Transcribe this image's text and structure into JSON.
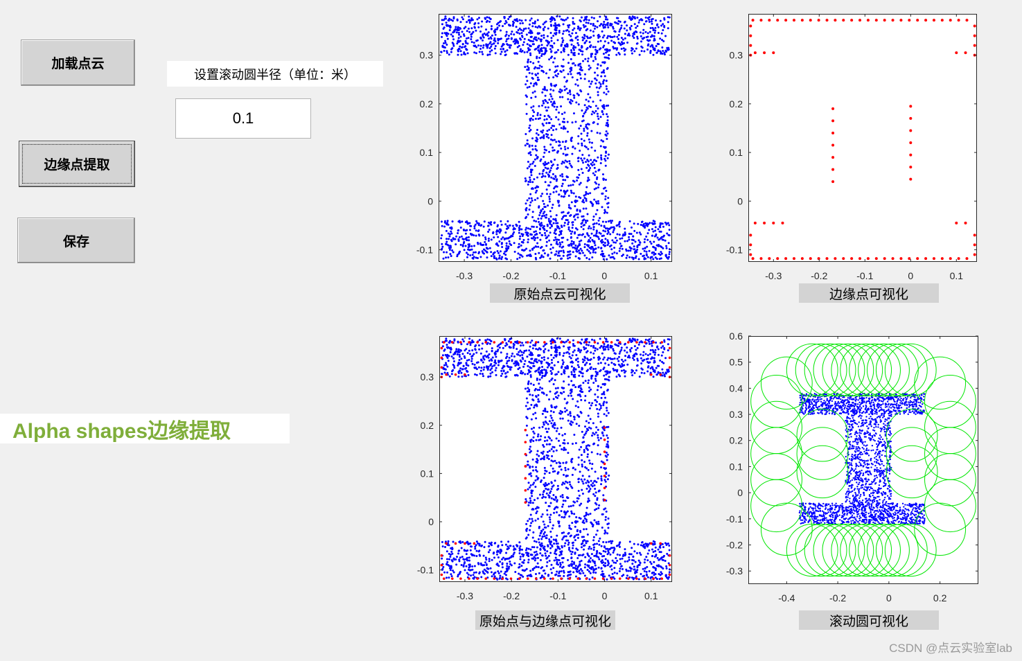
{
  "controls": {
    "load_label": "加载点云",
    "extract_label": "边缘点提取",
    "save_label": "保存",
    "radius_label": "设置滚动圆半径（单位：米）",
    "radius_value": "0.1"
  },
  "banner": {
    "title": "Alpha shapes边缘提取",
    "color": "#7fae3a"
  },
  "watermark": "CSDN @点云实验室lab",
  "colors": {
    "original": "#0000ff",
    "edge": "#ff0000",
    "circle": "#00e600"
  },
  "chart_data": [
    {
      "type": "scatter",
      "caption": "原始点云可视化",
      "xlim": [
        -0.355,
        0.145
      ],
      "ylim": [
        -0.125,
        0.385
      ],
      "xticks": [
        -0.3,
        -0.2,
        -0.1,
        0,
        0.1
      ],
      "yticks": [
        -0.1,
        0,
        0.1,
        0.2,
        0.3
      ],
      "series": [
        {
          "color": "#0000ff",
          "shape": "I-beam point cloud"
        }
      ]
    },
    {
      "type": "scatter",
      "caption": "边缘点可视化",
      "xlim": [
        -0.355,
        0.145
      ],
      "ylim": [
        -0.125,
        0.385
      ],
      "xticks": [
        -0.3,
        -0.2,
        -0.1,
        0,
        0.1
      ],
      "yticks": [
        -0.1,
        0,
        0.1,
        0.2,
        0.3
      ],
      "series": [
        {
          "color": "#ff0000",
          "shape": "boundary points"
        }
      ]
    },
    {
      "type": "scatter",
      "caption": "原始点与边缘点可视化",
      "xlim": [
        -0.355,
        0.145
      ],
      "ylim": [
        -0.125,
        0.385
      ],
      "xticks": [
        -0.3,
        -0.2,
        -0.1,
        0,
        0.1
      ],
      "yticks": [
        -0.1,
        0,
        0.1,
        0.2,
        0.3
      ],
      "series": [
        {
          "color": "#0000ff",
          "shape": "I-beam point cloud"
        },
        {
          "color": "#ff0000",
          "shape": "boundary points"
        }
      ]
    },
    {
      "type": "scatter",
      "caption": "滚动圆可视化",
      "xlim": [
        -0.55,
        0.35
      ],
      "ylim": [
        -0.35,
        0.6
      ],
      "xticks": [
        -0.4,
        -0.2,
        0,
        0.2
      ],
      "yticks": [
        -0.3,
        -0.2,
        -0.1,
        0,
        0.1,
        0.2,
        0.3,
        0.4,
        0.5,
        0.6
      ],
      "circle_radius": 0.1,
      "series": [
        {
          "color": "#0000ff",
          "shape": "I-beam point cloud"
        },
        {
          "color": "#00e600",
          "shape": "rolling circles r=0.1"
        }
      ]
    }
  ]
}
